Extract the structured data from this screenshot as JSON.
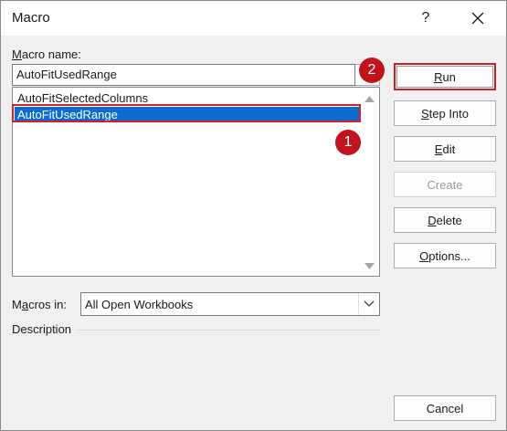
{
  "window": {
    "title": "Macro",
    "help_label": "?"
  },
  "macro_name": {
    "label_prefix": "M",
    "label_rest": "acro name:",
    "value": "AutoFitUsedRange"
  },
  "macro_list": {
    "items": [
      {
        "label": "AutoFitSelectedColumns",
        "selected": false
      },
      {
        "label": "AutoFitUsedRange",
        "selected": true
      }
    ]
  },
  "annotations": {
    "badge_1": "1",
    "badge_2": "2"
  },
  "buttons": {
    "run": {
      "hot": "R",
      "rest": "un"
    },
    "step_into": {
      "hot": "S",
      "rest": "tep Into"
    },
    "edit": {
      "hot": "E",
      "rest": "dit"
    },
    "create": {
      "label": "Create"
    },
    "delete": {
      "hot": "D",
      "rest": "elete"
    },
    "options": {
      "hot": "O",
      "rest": "ptions..."
    },
    "cancel": {
      "label": "Cancel"
    }
  },
  "macros_in": {
    "label_pre": "M",
    "label_hot": "a",
    "label_post": "cros in:",
    "value": "All Open Workbooks"
  },
  "description": {
    "label": "Description"
  },
  "colors": {
    "selection": "#0a6ccf",
    "highlight": "#d32027",
    "badge": "#c0141c"
  }
}
